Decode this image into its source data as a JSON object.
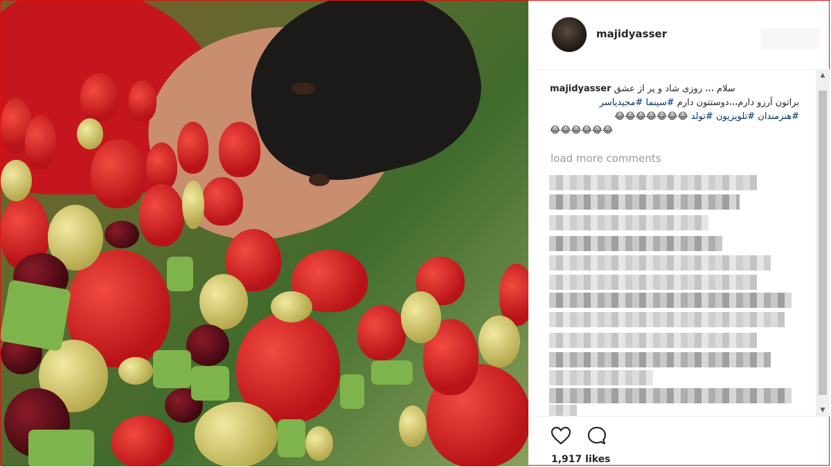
{
  "post": {
    "username": "majidyasser",
    "caption_username": "majidyasser",
    "caption_line1": "سلام ،،، روزی شاد و پر از عشق",
    "caption_line2_text": "براتون آرزو دارم،،،دوستتون دارم ",
    "caption_line2_tags": "#سینما #مجیدیاسر",
    "caption_line3_tags": "#هنرمندان #تلویزیون #تولد",
    "caption_line3_emoji": "😂😂😂😂😂😂😂",
    "caption_line4_emoji": "😂😂😂😂😂😂",
    "load_more": "load more comments",
    "likes": "1,917 likes"
  },
  "icons": {
    "like": "heart-icon",
    "comment": "comment-icon"
  },
  "colors": {
    "frame": "#dd1111",
    "hashtag": "#003569",
    "muted": "#999999"
  }
}
